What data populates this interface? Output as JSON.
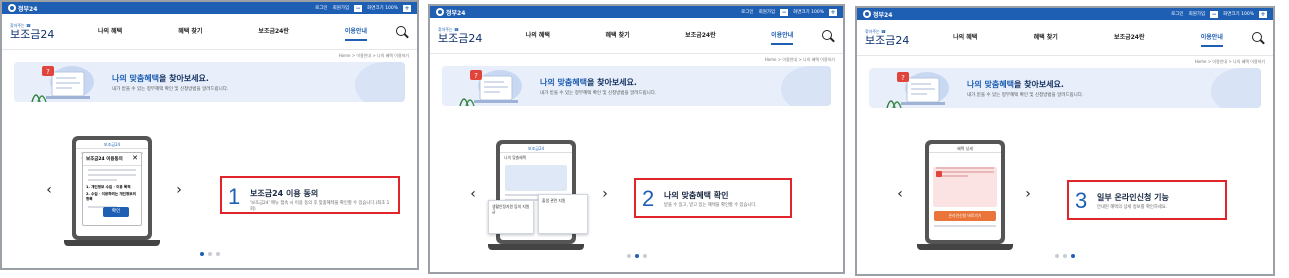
{
  "panels": [
    {
      "topbar": {
        "gov": "정부24",
        "login": "로그인",
        "join": "회원가입",
        "zoom": "화면크기 100%"
      },
      "header": {
        "logo_small": "찾아주는 ☎",
        "logo_big": "보조금24"
      },
      "nav": [
        "나의 혜택",
        "혜택 찾기",
        "보조금24란",
        "이용안내"
      ],
      "active_nav": 3,
      "breadcrumb": "Home  >  이용안내  >  나의 혜택 이용하기",
      "banner": {
        "title_pre": "나의 맞춤혜택",
        "title_post": "을 찾아보세요.",
        "subtitle": "내가 받을 수 있는 정부혜택 확인 및 신청방법을 알려드립니다."
      },
      "step": {
        "number": "1",
        "title": "보조금24 이용 동의",
        "desc": "'보조금24' 메뉴 접속 시 이용 동의 후 맞춤혜택을 확인할 수 있습니다.(최초 1회)"
      },
      "device": {
        "header": "보조금24",
        "modal_title": "보조금24 이용동의",
        "modal_item1": "1. 개인정보 수집 · 이용 목적",
        "modal_item2": "2. 수집 · 이용하려는 개인정보의 항목",
        "button": "확인"
      },
      "active_dot": 0
    },
    {
      "topbar": {
        "gov": "정부24",
        "login": "로그인",
        "join": "회원가입",
        "zoom": "화면크기 100%"
      },
      "header": {
        "logo_small": "찾아주는 ☎",
        "logo_big": "보조금24"
      },
      "nav": [
        "나의 혜택",
        "혜택 찾기",
        "보조금24란",
        "이용안내"
      ],
      "active_nav": 3,
      "breadcrumb": "Home  >  이용안내  >  나의 혜택 이용하기",
      "banner": {
        "title_pre": "나의 맞춤혜택",
        "title_post": "을 찾아보세요.",
        "subtitle": "내가 받을 수 있는 정부혜택 확인 및 신청방법을 알려드립니다."
      },
      "step": {
        "number": "2",
        "title": "나의 맞춤혜택 확인",
        "desc": "받을 수 있고, 받고 있는 혜택을 확인할 수 있습니다."
      },
      "device": {
        "header": "보조금24",
        "section": "나의 맞춤혜택",
        "card1": "생활안정지원 등의 지원금",
        "card2": "출생 관련 지원"
      },
      "active_dot": 1
    },
    {
      "topbar": {
        "gov": "정부24",
        "login": "로그인",
        "join": "회원가입",
        "zoom": "화면크기 100%"
      },
      "header": {
        "logo_small": "찾아주는 ☎",
        "logo_big": "보조금24"
      },
      "nav": [
        "나의 혜택",
        "혜택 찾기",
        "보조금24란",
        "이용안내"
      ],
      "active_nav": 3,
      "breadcrumb": "Home  >  이용안내  >  나의 혜택 이용하기",
      "banner": {
        "title_pre": "나의 맞춤혜택",
        "title_post": "을 찾아보세요.",
        "subtitle": "내가 받을 수 있는 정부혜택 확인 및 신청방법을 알려드립니다."
      },
      "step": {
        "number": "3",
        "title": "일부 온라인신청 기능",
        "desc": "안내된 혜택의 상세 정보를 확인하세요."
      },
      "device": {
        "header": "혜택 상세",
        "button": "온라인신청 바로가기"
      },
      "active_dot": 2
    }
  ],
  "colors": {
    "brand": "#1f5fb3",
    "highlight_border": "#e0252a",
    "banner_bg": "#e8effb"
  }
}
